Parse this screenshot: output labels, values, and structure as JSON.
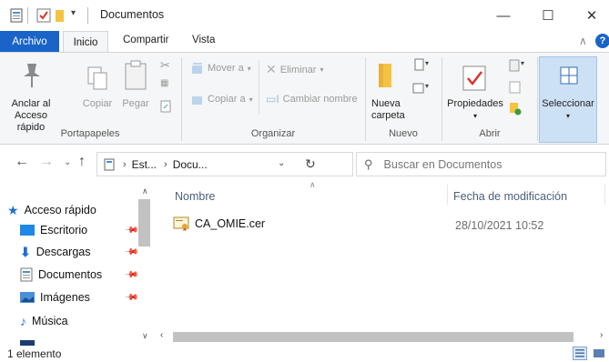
{
  "window": {
    "title": "Documentos",
    "minimize": "—",
    "maximize": "☐",
    "close": "✕"
  },
  "ribbon_tabs": {
    "file": "Archivo",
    "home": "Inicio",
    "share": "Compartir",
    "view": "Vista"
  },
  "ribbon": {
    "pin_line1": "Anclar al",
    "pin_line2": "Acceso rápido",
    "copy": "Copiar",
    "paste": "Pegar",
    "group_clipboard": "Portapapeles",
    "move_to": "Mover a",
    "copy_to": "Copiar a",
    "delete": "Eliminar",
    "rename": "Cambiar nombre",
    "group_organize": "Organizar",
    "new_folder_line1": "Nueva",
    "new_folder_line2": "carpeta",
    "group_new": "Nuevo",
    "properties": "Propiedades",
    "group_open": "Abrir",
    "select": "Seleccionar",
    "accent": "#1a63c7"
  },
  "address": {
    "crumb1": "Est...",
    "crumb2": "Docu...",
    "search_placeholder": "Buscar en Documentos"
  },
  "nav": {
    "quick_access": "Acceso rápido",
    "items": [
      {
        "label": "Escritorio",
        "icon": "desktop-icon"
      },
      {
        "label": "Descargas",
        "icon": "downloads-icon"
      },
      {
        "label": "Documentos",
        "icon": "documents-icon"
      },
      {
        "label": "Imágenes",
        "icon": "pictures-icon"
      },
      {
        "label": "Música",
        "icon": "music-icon"
      }
    ]
  },
  "columns": {
    "name": "Nombre",
    "modified": "Fecha de modificación"
  },
  "files": [
    {
      "name": "CA_OMIE.cer",
      "modified": "28/10/2021 10:52",
      "icon": "certificate-file-icon"
    }
  ],
  "status": {
    "count": "1 elemento"
  }
}
